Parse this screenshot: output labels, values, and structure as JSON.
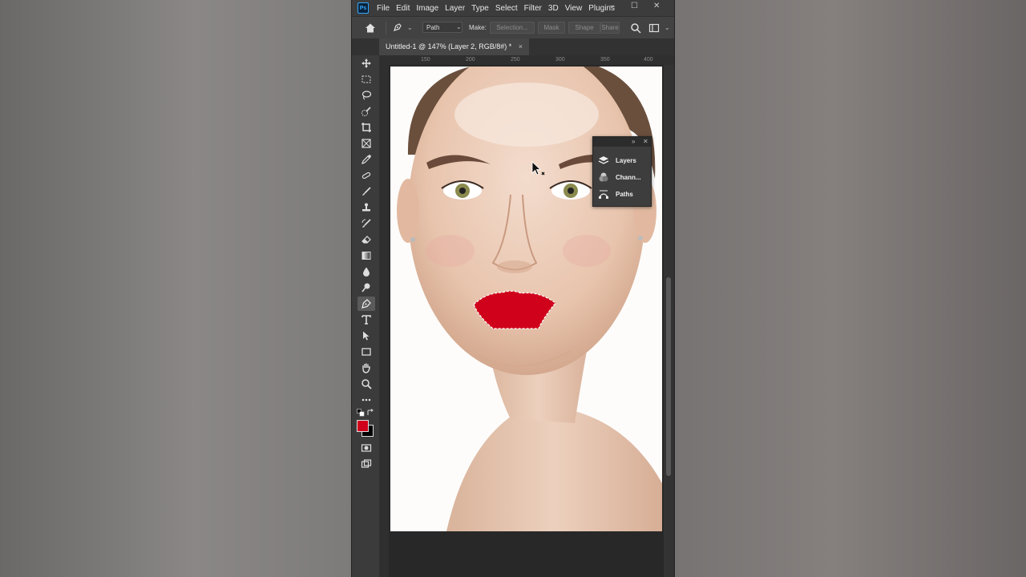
{
  "menu": {
    "logo": "Ps",
    "items": [
      "File",
      "Edit",
      "Image",
      "Layer",
      "Type",
      "Select",
      "Filter",
      "3D",
      "View",
      "Plugins"
    ]
  },
  "options": {
    "mode_value": "Path",
    "make_label": "Make:",
    "selection_btn": "Selection...",
    "mask_btn": "Mask",
    "shape_btn": "Shape",
    "share_btn": "Share"
  },
  "tab": {
    "title": "Untitled-1 @ 147% (Layer 2, RGB/8#) *",
    "close": "×"
  },
  "ruler": {
    "ticks": [
      "150",
      "200",
      "250",
      "300",
      "350",
      "400"
    ]
  },
  "panel": {
    "layers_label": "Layers",
    "channels_label": "Chann...",
    "paths_label": "Paths"
  },
  "colors": {
    "foreground": "#d0021b",
    "background": "#000000",
    "accent": "#31a8ff"
  }
}
